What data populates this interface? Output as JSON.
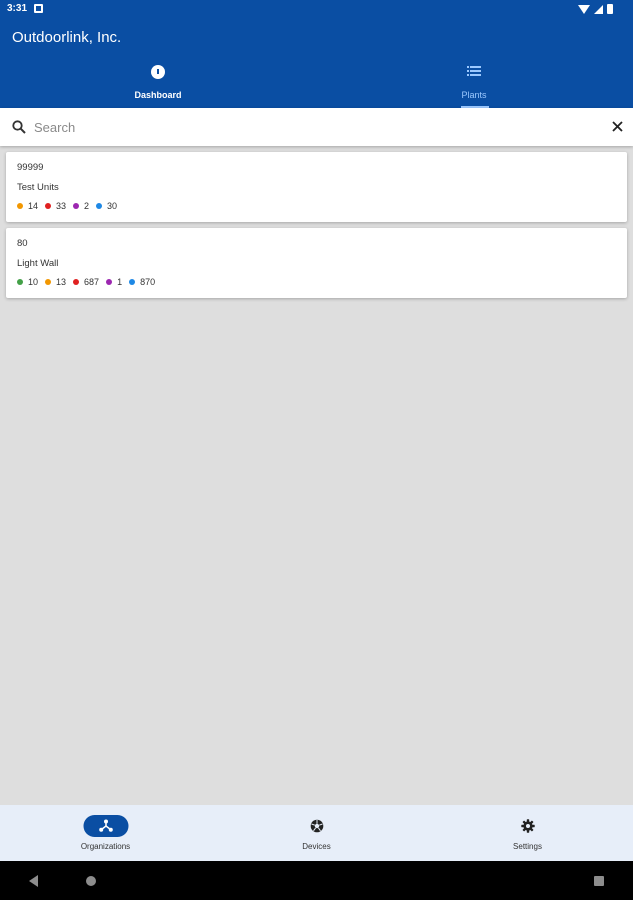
{
  "status_bar": {
    "time": "3:31"
  },
  "app_bar": {
    "title": "Outdoorlink, Inc.",
    "tabs": [
      {
        "label": "Dashboard",
        "icon": "dashboard-icon",
        "active": false
      },
      {
        "label": "Plants",
        "icon": "list-icon",
        "active": true
      }
    ]
  },
  "search": {
    "placeholder": "Search",
    "value": ""
  },
  "plants": [
    {
      "id": "99999",
      "name": "Test Units",
      "stats": [
        {
          "color": "#f29700",
          "value": "14"
        },
        {
          "color": "#e02020",
          "value": "33"
        },
        {
          "color": "#9c27b0",
          "value": "2"
        },
        {
          "color": "#1e88e5",
          "value": "30"
        }
      ]
    },
    {
      "id": "80",
      "name": "Light Wall",
      "stats": [
        {
          "color": "#43a047",
          "value": "10"
        },
        {
          "color": "#f29700",
          "value": "13"
        },
        {
          "color": "#e02020",
          "value": "687"
        },
        {
          "color": "#9c27b0",
          "value": "1"
        },
        {
          "color": "#1e88e5",
          "value": "870"
        }
      ]
    }
  ],
  "bottom_nav": [
    {
      "label": "Organizations",
      "icon": "organizations-icon",
      "active": true
    },
    {
      "label": "Devices",
      "icon": "devices-icon",
      "active": false
    },
    {
      "label": "Settings",
      "icon": "gear-icon",
      "active": false
    }
  ],
  "colors": {
    "primary": "#0a4ea3",
    "accent": "#9cc9ff",
    "background": "#dedede",
    "nav_background": "#e7eef9"
  }
}
